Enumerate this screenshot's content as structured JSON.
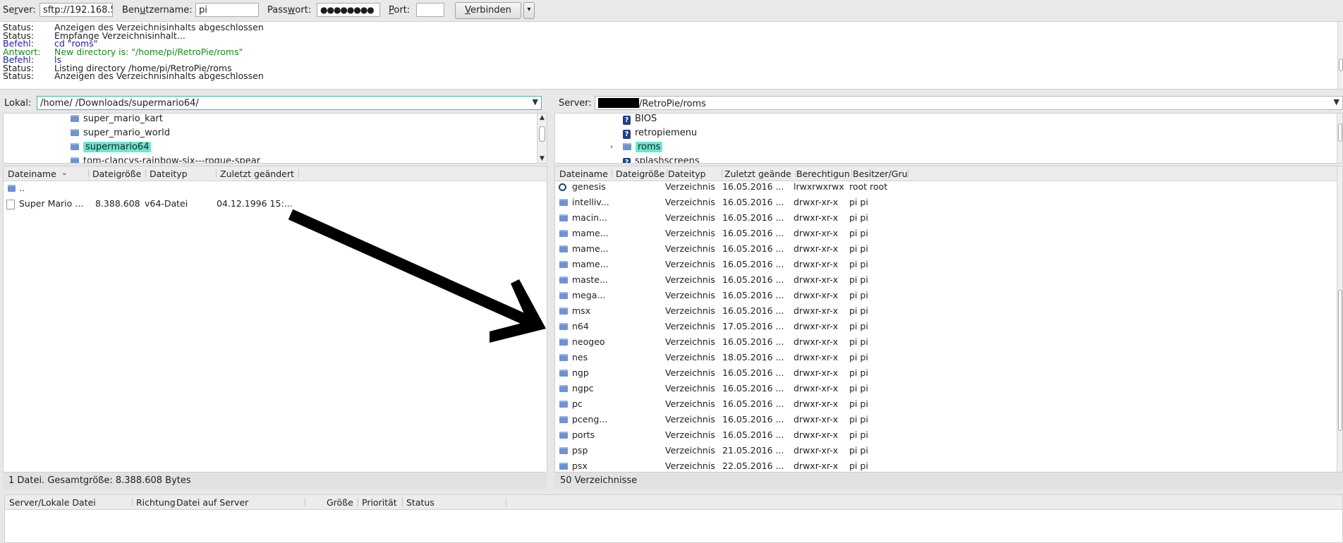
{
  "quickconnect": {
    "server_label": "Server:",
    "server_value": "sftp://192.168.5",
    "user_label": "Benutzername:",
    "user_value": "pi",
    "password_label": "Passwort:",
    "password_value": "●●●●●●●●",
    "port_label": "Port:",
    "port_value": "",
    "connect_label": "Verbinden"
  },
  "log": [
    {
      "kind": "Status:",
      "text": "Anzeigen des Verzeichnisinhalts abgeschlossen",
      "color": "#1e1e1e"
    },
    {
      "kind": "Status:",
      "text": "Empfange Verzeichnisinhalt...",
      "color": "#1e1e1e"
    },
    {
      "kind": "Befehl:",
      "text": "cd \"roms\"",
      "color": "#1c1cad"
    },
    {
      "kind": "Antwort:",
      "text": "New directory is: \"/home/pi/RetroPie/roms\"",
      "color": "#168c16"
    },
    {
      "kind": "Befehl:",
      "text": "ls",
      "color": "#1c1cad"
    },
    {
      "kind": "Status:",
      "text": "Listing directory /home/pi/RetroPie/roms",
      "color": "#1e1e1e"
    },
    {
      "kind": "Status:",
      "text": "Anzeigen des Verzeichnisinhalts abgeschlossen",
      "color": "#1e1e1e"
    }
  ],
  "local": {
    "label": "Lokal:",
    "path": "/home/ /Downloads/supermario64/",
    "tree": [
      "super_mario_kart",
      "super_mario_world",
      "supermario64",
      "tom-clancys-rainbow-six---rogue-spear"
    ],
    "tree_selected": "supermario64",
    "columns": [
      "Dateiname",
      "Dateigröße",
      "Dateityp",
      "Zuletzt geändert"
    ],
    "files": [
      {
        "name": "..",
        "size": "",
        "type": "",
        "modified": ""
      },
      {
        "name": "Super Mario ...",
        "size": "8.388.608",
        "type": "v64-Datei",
        "modified": "04.12.1996 15:..."
      }
    ],
    "status": "1 Datei. Gesamtgröße: 8.388.608 Bytes"
  },
  "remote": {
    "label": "Server:",
    "path_suffix": "/RetroPie/roms",
    "tree": [
      "BIOS",
      "retropiemenu",
      "roms",
      "splashscreens"
    ],
    "tree_selected": "roms",
    "columns": [
      "Dateiname",
      "Dateigröße",
      "Dateityp",
      "Zuletzt geände",
      "Berechtigun",
      "Besitzer/Gru"
    ],
    "files": [
      {
        "name": "genesis",
        "type": "Verzeichnis",
        "modified": "16.05.2016 ...",
        "perm": "lrwxrwxrwx",
        "owner": "root root"
      },
      {
        "name": "intelliv...",
        "type": "Verzeichnis",
        "modified": "16.05.2016 ...",
        "perm": "drwxr-xr-x",
        "owner": "pi pi"
      },
      {
        "name": "macin...",
        "type": "Verzeichnis",
        "modified": "16.05.2016 ...",
        "perm": "drwxr-xr-x",
        "owner": "pi pi"
      },
      {
        "name": "mame...",
        "type": "Verzeichnis",
        "modified": "16.05.2016 ...",
        "perm": "drwxr-xr-x",
        "owner": "pi pi"
      },
      {
        "name": "mame...",
        "type": "Verzeichnis",
        "modified": "16.05.2016 ...",
        "perm": "drwxr-xr-x",
        "owner": "pi pi"
      },
      {
        "name": "mame...",
        "type": "Verzeichnis",
        "modified": "16.05.2016 ...",
        "perm": "drwxr-xr-x",
        "owner": "pi pi"
      },
      {
        "name": "maste...",
        "type": "Verzeichnis",
        "modified": "16.05.2016 ...",
        "perm": "drwxr-xr-x",
        "owner": "pi pi"
      },
      {
        "name": "mega...",
        "type": "Verzeichnis",
        "modified": "16.05.2016 ...",
        "perm": "drwxr-xr-x",
        "owner": "pi pi"
      },
      {
        "name": "msx",
        "type": "Verzeichnis",
        "modified": "16.05.2016 ...",
        "perm": "drwxr-xr-x",
        "owner": "pi pi"
      },
      {
        "name": "n64",
        "type": "Verzeichnis",
        "modified": "17.05.2016 ...",
        "perm": "drwxr-xr-x",
        "owner": "pi pi"
      },
      {
        "name": "neogeo",
        "type": "Verzeichnis",
        "modified": "16.05.2016 ...",
        "perm": "drwxr-xr-x",
        "owner": "pi pi"
      },
      {
        "name": "nes",
        "type": "Verzeichnis",
        "modified": "18.05.2016 ...",
        "perm": "drwxr-xr-x",
        "owner": "pi pi"
      },
      {
        "name": "ngp",
        "type": "Verzeichnis",
        "modified": "16.05.2016 ...",
        "perm": "drwxr-xr-x",
        "owner": "pi pi"
      },
      {
        "name": "ngpc",
        "type": "Verzeichnis",
        "modified": "16.05.2016 ...",
        "perm": "drwxr-xr-x",
        "owner": "pi pi"
      },
      {
        "name": "pc",
        "type": "Verzeichnis",
        "modified": "16.05.2016 ...",
        "perm": "drwxr-xr-x",
        "owner": "pi pi"
      },
      {
        "name": "pceng...",
        "type": "Verzeichnis",
        "modified": "16.05.2016 ...",
        "perm": "drwxr-xr-x",
        "owner": "pi pi"
      },
      {
        "name": "ports",
        "type": "Verzeichnis",
        "modified": "16.05.2016 ...",
        "perm": "drwxr-xr-x",
        "owner": "pi pi"
      },
      {
        "name": "psp",
        "type": "Verzeichnis",
        "modified": "21.05.2016 ...",
        "perm": "drwxr-xr-x",
        "owner": "pi pi"
      },
      {
        "name": "psx",
        "type": "Verzeichnis",
        "modified": "22.05.2016 ...",
        "perm": "drwxr-xr-x",
        "owner": "pi pi"
      }
    ],
    "status": "50 Verzeichnisse"
  },
  "queue": {
    "columns": [
      "Server/Lokale Datei",
      "Richtung",
      "Datei auf Server",
      "Größe",
      "Priorität",
      "Status"
    ]
  },
  "colors": {
    "selection": "#6ee6d2",
    "folder": "#6f92d4",
    "focus_border": "#3fb8a8"
  }
}
